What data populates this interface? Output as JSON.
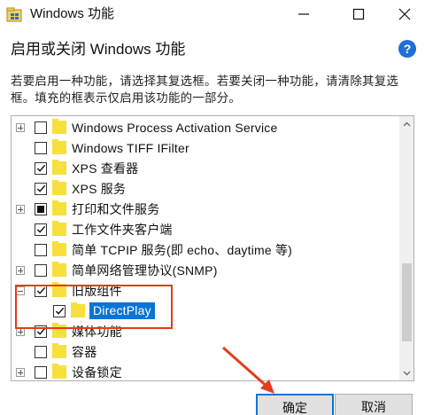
{
  "window": {
    "title": "Windows 功能",
    "icon": "windows-features-icon"
  },
  "header": {
    "heading": "启用或关闭 Windows 功能",
    "description": "若要启用一种功能，请选择其复选框。若要关闭一种功能，请清除其复选框。填充的框表示仅启用该功能的一部分。"
  },
  "features": [
    {
      "label": "Windows Process Activation Service",
      "expander": "plus",
      "state": "unchecked"
    },
    {
      "label": "Windows TIFF IFilter",
      "expander": "none",
      "state": "unchecked"
    },
    {
      "label": "XPS 查看器",
      "expander": "none",
      "state": "checked"
    },
    {
      "label": "XPS 服务",
      "expander": "none",
      "state": "checked"
    },
    {
      "label": "打印和文件服务",
      "expander": "plus",
      "state": "partial"
    },
    {
      "label": "工作文件夹客户端",
      "expander": "none",
      "state": "checked"
    },
    {
      "label": "简单 TCPIP 服务(即 echo、daytime 等)",
      "expander": "none",
      "state": "unchecked"
    },
    {
      "label": "简单网络管理协议(SNMP)",
      "expander": "plus",
      "state": "unchecked"
    },
    {
      "label": "旧版组件",
      "expander": "minus",
      "state": "checked"
    },
    {
      "label": "DirectPlay",
      "expander": "none",
      "state": "checked",
      "child": true,
      "selected": true
    },
    {
      "label": "媒体功能",
      "expander": "plus",
      "state": "checked"
    },
    {
      "label": "容器",
      "expander": "none",
      "state": "unchecked"
    },
    {
      "label": "设备锁定",
      "expander": "plus",
      "state": "unchecked"
    }
  ],
  "buttons": {
    "ok": "确定",
    "cancel": "取消"
  },
  "colors": {
    "selection": "#0a74d6",
    "highlight_annotation": "#e63a1e",
    "folder": "#f7e03c"
  }
}
